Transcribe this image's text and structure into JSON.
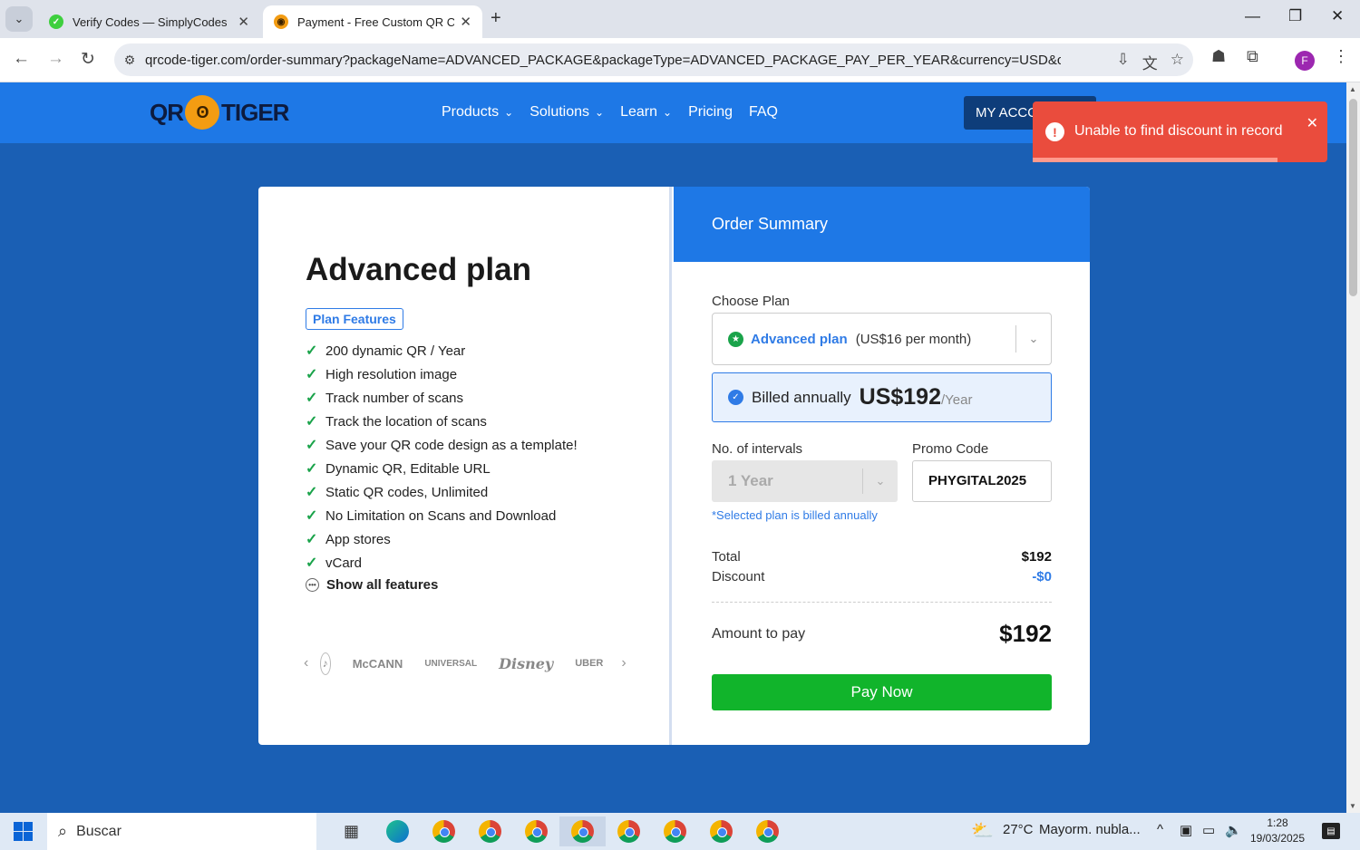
{
  "browser": {
    "tabs": [
      {
        "title": "Verify Codes — SimplyCodes",
        "favicon_color": "#3ecf3e"
      },
      {
        "title": "Payment - Free Custom QR Cod",
        "favicon_color": "#f39c12"
      }
    ],
    "url": "qrcode-tiger.com/order-summary?packageName=ADVANCED_PACKAGE&packageType=ADVANCED_PACKAGE_PAY_PER_YEAR&currency=USD&currentRate=",
    "profile_initial": "F"
  },
  "site": {
    "logo_left": "QR",
    "logo_right": "TIGER",
    "nav": [
      {
        "label": "Products",
        "has_dropdown": true
      },
      {
        "label": "Solutions",
        "has_dropdown": true
      },
      {
        "label": "Learn",
        "has_dropdown": true
      },
      {
        "label": "Pricing",
        "has_dropdown": false
      },
      {
        "label": "FAQ",
        "has_dropdown": false
      }
    ],
    "account_button": "MY ACCO",
    "colors": {
      "header": "#1e78e6",
      "page_bg": "#1a5fb4",
      "pay_button": "#11b42b",
      "toast": "#ea4c3d"
    }
  },
  "toast": {
    "message": "Unable to find discount in record",
    "progress": 0.83
  },
  "plan": {
    "title": "Advanced plan",
    "features_badge": "Plan Features",
    "features": [
      "200 dynamic QR / Year",
      "High resolution image",
      "Track number of scans",
      "Track the location of scans",
      "Save your QR code design as a template!",
      "Dynamic QR, Editable URL",
      "Static QR codes, Unlimited",
      "No Limitation on Scans and Download",
      "App stores",
      "vCard"
    ],
    "show_all": "Show all features",
    "brands": [
      "McCANN",
      "UNIVERSAL",
      "Disney",
      "UBER"
    ]
  },
  "order": {
    "heading": "Order Summary",
    "choose_plan_label": "Choose Plan",
    "selected_plan_name": "Advanced plan",
    "selected_plan_price": "(US$16 per month)",
    "billed_label": "Billed annually",
    "billed_amount": "US$192",
    "billed_period": "/Year",
    "intervals_label": "No. of intervals",
    "intervals_value": "1 Year",
    "promo_label": "Promo Code",
    "promo_value": "PHYGITAL2025",
    "hint": "*Selected plan is billed annually",
    "total_label": "Total",
    "total_value": "$192",
    "discount_label": "Discount",
    "discount_value": "-$0",
    "amount_label": "Amount to pay",
    "amount_value": "$192",
    "pay_button": "Pay Now"
  },
  "taskbar": {
    "search_placeholder": "Buscar",
    "weather_temp": "27°C",
    "weather_desc": "Mayorm. nubla...",
    "time": "1:28",
    "date": "19/03/2025",
    "app_badges": [
      "Y",
      "",
      "D",
      "F",
      "k",
      "P",
      "L",
      "9"
    ]
  }
}
